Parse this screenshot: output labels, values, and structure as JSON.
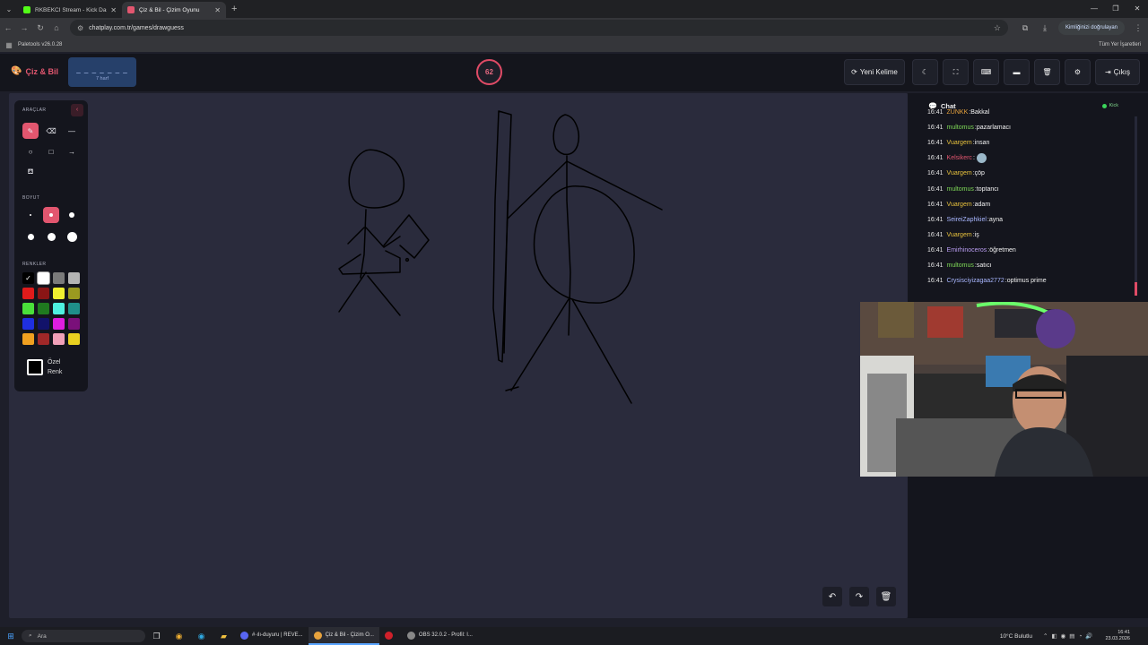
{
  "browser": {
    "tabs": [
      {
        "title": "RKBEKCI Stream - Kick Dashbo",
        "fav_color": "#53fc18",
        "active": false
      },
      {
        "title": "Çiz & Bil - Çizim Oyunu",
        "fav_color": "#e2566f",
        "active": true
      }
    ],
    "url": "chatplay.com.tr/games/drawguess",
    "verify_label": "Kimliğinizi doğrulayan",
    "bookmark": "Paletools v26.0.28",
    "all_bookmarks": "Tüm Yer İşaretleri"
  },
  "app": {
    "logo": "Çiz & Bil",
    "word_hint": "_ _ _ _ _ _ _",
    "letter_count": "7 harf",
    "timer": "62",
    "new_word": "Yeni Kelime",
    "exit": "Çıkış"
  },
  "tools": {
    "title_tools": "ARAÇLAR",
    "title_size": "BOYUT",
    "title_colors": "RENKLER",
    "custom_color": "Özel Renk",
    "colors": [
      "#000000",
      "#ffffff",
      "#7a7a7a",
      "#b4b4b4",
      "#e01b1b",
      "#8a1515",
      "#f0f030",
      "#9a9a20",
      "#4ae03a",
      "#1f7a1f",
      "#4ef0e0",
      "#1f8f8a",
      "#1f2fe0",
      "#12126a",
      "#e01ee0",
      "#7a107a",
      "#f0a020",
      "#a02828",
      "#f0a0b8",
      "#e8d020"
    ]
  },
  "chat": {
    "title": "Chat",
    "platform": "Kick",
    "messages": [
      {
        "time": "16:41",
        "user": "ZUNKK",
        "color": "#e8a33d",
        "text": "Bakkal"
      },
      {
        "time": "16:41",
        "user": "multomus",
        "color": "#7ed957",
        "text": "pazarlamacı"
      },
      {
        "time": "16:41",
        "user": "Vuargem",
        "color": "#e8c23d",
        "text": "insan"
      },
      {
        "time": "16:41",
        "user": "Kelsikerc",
        "color": "#e2566f",
        "text": ""
      },
      {
        "time": "16:41",
        "user": "Vuargem",
        "color": "#e8c23d",
        "text": "çöp"
      },
      {
        "time": "16:41",
        "user": "multomus",
        "color": "#7ed957",
        "text": "toptancı"
      },
      {
        "time": "16:41",
        "user": "Vuargem",
        "color": "#e8c23d",
        "text": "adam"
      },
      {
        "time": "16:41",
        "user": "SeireiZaphkiel",
        "color": "#a9b7ff",
        "text": "ayna"
      },
      {
        "time": "16:41",
        "user": "Vuargem",
        "color": "#e8c23d",
        "text": "iş"
      },
      {
        "time": "16:41",
        "user": "Emirhinoceros",
        "color": "#b89cf0",
        "text": "öğretmen"
      },
      {
        "time": "16:41",
        "user": "multomus",
        "color": "#7ed957",
        "text": "satıcı"
      },
      {
        "time": "16:41",
        "user": "Crysisciyizagaa2772",
        "color": "#a9b7ff",
        "text": "optimus prime"
      }
    ]
  },
  "taskbar": {
    "search": "Ara",
    "apps": [
      {
        "label": "#·ılı-duyuru | REVE...",
        "color": "#5865f2",
        "active": false
      },
      {
        "label": "Çiz & Bil - Çizim O...",
        "color": "#e8a33d",
        "active": true
      },
      {
        "label": "",
        "color": "#d0202a",
        "active": false
      },
      {
        "label": "OBS 32.0.2 - Profil: I...",
        "color": "#888888",
        "active": false
      }
    ],
    "weather": "10°C  Bulutlu",
    "time": "16:41",
    "date": "23.03.2026"
  }
}
